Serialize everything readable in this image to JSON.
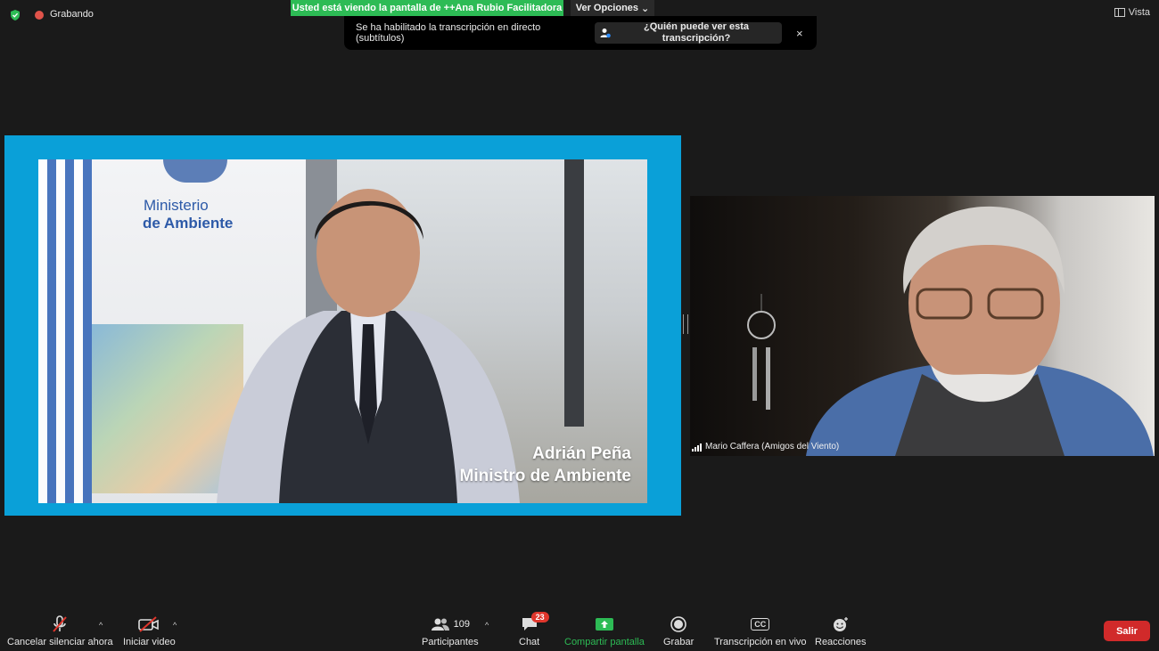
{
  "topbar": {
    "recording_label": "Grabando",
    "banner_text": "Usted está viendo la pantalla de ++Ana Rubio Facilitadora",
    "view_options_label": "Ver Opciones",
    "view_label": "Vista"
  },
  "notice": {
    "text": "Se ha habilitado la transcripción en directo (subtítulos)",
    "who_button": "¿Quién puede ver esta transcripción?",
    "close": "×"
  },
  "shared_screen": {
    "sign_line1": "Ministerio",
    "sign_line2": "de Ambiente",
    "caption_name": "Adrián Peña",
    "caption_title": "Ministro de Ambiente"
  },
  "participant": {
    "name": "Mario Caffera (Amigos del Viento)"
  },
  "toolbar": {
    "mute_label": "Cancelar silenciar ahora",
    "video_label": "Iniciar video",
    "participants_label": "Participantes",
    "participants_count": "109",
    "chat_label": "Chat",
    "chat_badge": "23",
    "share_label": "Compartir pantalla",
    "record_label": "Grabar",
    "transcription_label": "Transcripción en vivo",
    "reactions_label": "Reacciones",
    "leave_label": "Salir",
    "cc_text": "CC"
  },
  "colors": {
    "share_green": "#2dbb55",
    "leave_red": "#d12a2a",
    "share_border": "#0aa0d8"
  }
}
